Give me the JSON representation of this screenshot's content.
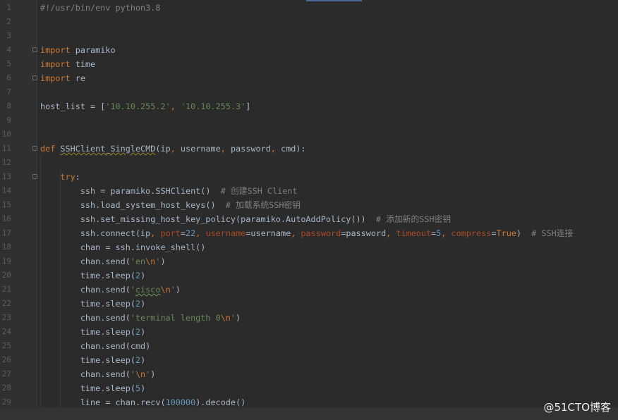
{
  "editor": {
    "language": "python",
    "theme_colors": {
      "background": "#2b2b2b",
      "keyword": "#cc7832",
      "string": "#6a8759",
      "number": "#6897bb",
      "comment": "#808080",
      "param": "#aa4926",
      "default": "#a9b7c6"
    },
    "lines": [
      {
        "n": "1",
        "tokens": [
          [
            "c",
            "#!/usr/bin/env python3.8"
          ]
        ]
      },
      {
        "n": "2",
        "tokens": []
      },
      {
        "n": "3",
        "tokens": []
      },
      {
        "n": "4",
        "fold": true,
        "tokens": [
          [
            "k",
            "import"
          ],
          [
            "t",
            " paramiko"
          ]
        ]
      },
      {
        "n": "5",
        "tokens": [
          [
            "k",
            "import"
          ],
          [
            "t",
            " time"
          ]
        ]
      },
      {
        "n": "6",
        "fold": true,
        "tokens": [
          [
            "k",
            "import"
          ],
          [
            "t",
            " re"
          ]
        ]
      },
      {
        "n": "7",
        "tokens": []
      },
      {
        "n": "8",
        "tokens": [
          [
            "t",
            "host_list = ["
          ],
          [
            "s",
            "'10.10.255.2'"
          ],
          [
            "k",
            ", "
          ],
          [
            "s",
            "'10.10.255.3'"
          ],
          [
            "t",
            "]"
          ]
        ]
      },
      {
        "n": "9",
        "tokens": []
      },
      {
        "n": "10",
        "tokens": []
      },
      {
        "n": "11",
        "fold": true,
        "tokens": [
          [
            "k",
            "def "
          ],
          [
            "f",
            "SSHClient_SingleCMD"
          ],
          [
            "t",
            "(ip"
          ],
          [
            "k",
            ", "
          ],
          [
            "t",
            "username"
          ],
          [
            "k",
            ", "
          ],
          [
            "t",
            "password"
          ],
          [
            "k",
            ", "
          ],
          [
            "t",
            "cmd):"
          ]
        ]
      },
      {
        "n": "12",
        "tokens": []
      },
      {
        "n": "13",
        "fold": true,
        "tokens": [
          [
            "t",
            "    "
          ],
          [
            "k",
            "try"
          ],
          [
            "t",
            ":"
          ]
        ]
      },
      {
        "n": "14",
        "tokens": [
          [
            "t",
            "        ssh = paramiko.SSHClient()  "
          ],
          [
            "c",
            "# 创建SSH Client"
          ]
        ]
      },
      {
        "n": "15",
        "tokens": [
          [
            "t",
            "        ssh.load_system_host_keys()  "
          ],
          [
            "c",
            "# 加载系统SSH密钥"
          ]
        ]
      },
      {
        "n": "16",
        "tokens": [
          [
            "t",
            "        ssh.set_missing_host_key_policy(paramiko.AutoAddPolicy())  "
          ],
          [
            "c",
            "# 添加新的SSH密钥"
          ]
        ]
      },
      {
        "n": "17",
        "tokens": [
          [
            "t",
            "        ssh.connect(ip"
          ],
          [
            "k",
            ", "
          ],
          [
            "p",
            "port"
          ],
          [
            "t",
            "="
          ],
          [
            "n",
            "22"
          ],
          [
            "k",
            ", "
          ],
          [
            "p",
            "username"
          ],
          [
            "t",
            "=username"
          ],
          [
            "k",
            ", "
          ],
          [
            "p",
            "password"
          ],
          [
            "t",
            "=password"
          ],
          [
            "k",
            ", "
          ],
          [
            "p",
            "timeout"
          ],
          [
            "t",
            "="
          ],
          [
            "n",
            "5"
          ],
          [
            "k",
            ", "
          ],
          [
            "p",
            "compress"
          ],
          [
            "t",
            "="
          ],
          [
            "k",
            "True"
          ],
          [
            "t",
            ")  "
          ],
          [
            "c",
            "# SSH连接"
          ]
        ]
      },
      {
        "n": "18",
        "tokens": [
          [
            "t",
            "        chan = ssh.invoke_shell()"
          ]
        ]
      },
      {
        "n": "19",
        "tokens": [
          [
            "t",
            "        chan.send("
          ],
          [
            "s",
            "'en"
          ],
          [
            "e",
            "\\n"
          ],
          [
            "s",
            "'"
          ],
          [
            "t",
            ")"
          ]
        ]
      },
      {
        "n": "20",
        "tokens": [
          [
            "t",
            "        time.sleep("
          ],
          [
            "n",
            "2"
          ],
          [
            "t",
            ")"
          ]
        ]
      },
      {
        "n": "21",
        "tokens": [
          [
            "t",
            "        chan.send("
          ],
          [
            "s",
            "'"
          ],
          [
            "w",
            "cisco"
          ],
          [
            "e",
            "\\n"
          ],
          [
            "s",
            "'"
          ],
          [
            "t",
            ")"
          ]
        ]
      },
      {
        "n": "22",
        "tokens": [
          [
            "t",
            "        time.sleep("
          ],
          [
            "n",
            "2"
          ],
          [
            "t",
            ")"
          ]
        ]
      },
      {
        "n": "23",
        "tokens": [
          [
            "t",
            "        chan.send("
          ],
          [
            "s",
            "'terminal length 0"
          ],
          [
            "e",
            "\\n"
          ],
          [
            "s",
            "'"
          ],
          [
            "t",
            ")"
          ]
        ]
      },
      {
        "n": "24",
        "tokens": [
          [
            "t",
            "        time.sleep("
          ],
          [
            "n",
            "2"
          ],
          [
            "t",
            ")"
          ]
        ]
      },
      {
        "n": "25",
        "tokens": [
          [
            "t",
            "        chan.send(cmd)"
          ]
        ]
      },
      {
        "n": "26",
        "tokens": [
          [
            "t",
            "        time.sleep("
          ],
          [
            "n",
            "2"
          ],
          [
            "t",
            ")"
          ]
        ]
      },
      {
        "n": "27",
        "tokens": [
          [
            "t",
            "        chan.send("
          ],
          [
            "s",
            "'"
          ],
          [
            "e",
            "\\n"
          ],
          [
            "s",
            "'"
          ],
          [
            "t",
            ")"
          ]
        ]
      },
      {
        "n": "28",
        "tokens": [
          [
            "t",
            "        time.sleep("
          ],
          [
            "n",
            "5"
          ],
          [
            "t",
            ")"
          ]
        ]
      },
      {
        "n": "29",
        "tokens": [
          [
            "t",
            "        line = chan.recv("
          ],
          [
            "n",
            "100000"
          ],
          [
            "t",
            ").decode()"
          ]
        ]
      }
    ]
  },
  "watermark": "@51CTO博客"
}
